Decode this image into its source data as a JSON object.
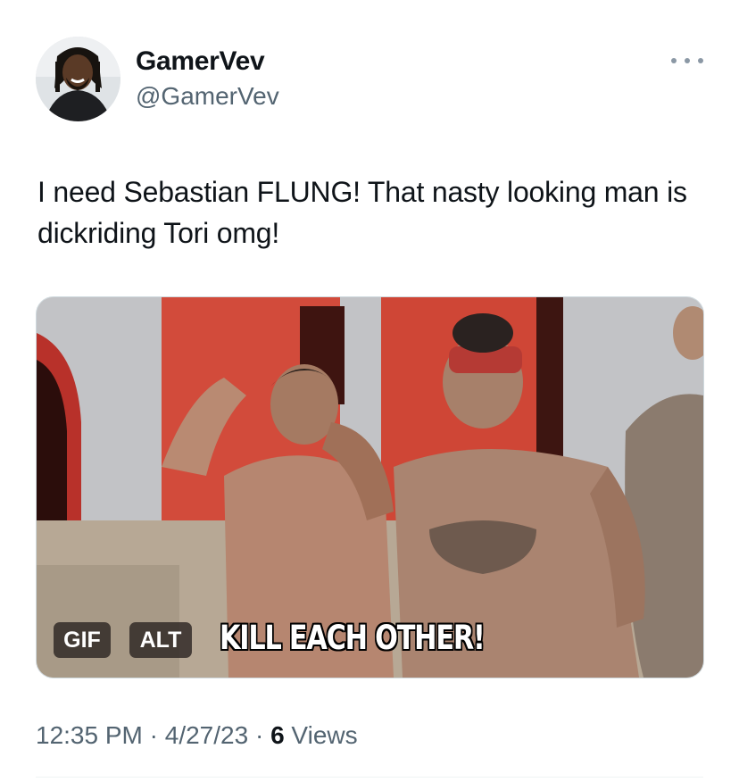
{
  "author": {
    "display_name": "GamerVev",
    "handle": "@GamerVev",
    "avatar_icon": "profile-photo"
  },
  "more_icon": "more-horizontal-icon",
  "tweet": {
    "text": "I need Sebastian FLUNG! That nasty looking man is dickriding Tori omg!"
  },
  "media": {
    "gif_badge": "GIF",
    "alt_badge": "ALT",
    "caption": "KILL EACH OTHER!"
  },
  "meta": {
    "time": "12:35 PM",
    "sep1": "·",
    "date": "4/27/23",
    "sep2": "·",
    "views_count": "6",
    "views_label": "Views"
  },
  "colors": {
    "text_primary": "#0f1419",
    "text_secondary": "#536471",
    "border": "#cfd9de"
  }
}
